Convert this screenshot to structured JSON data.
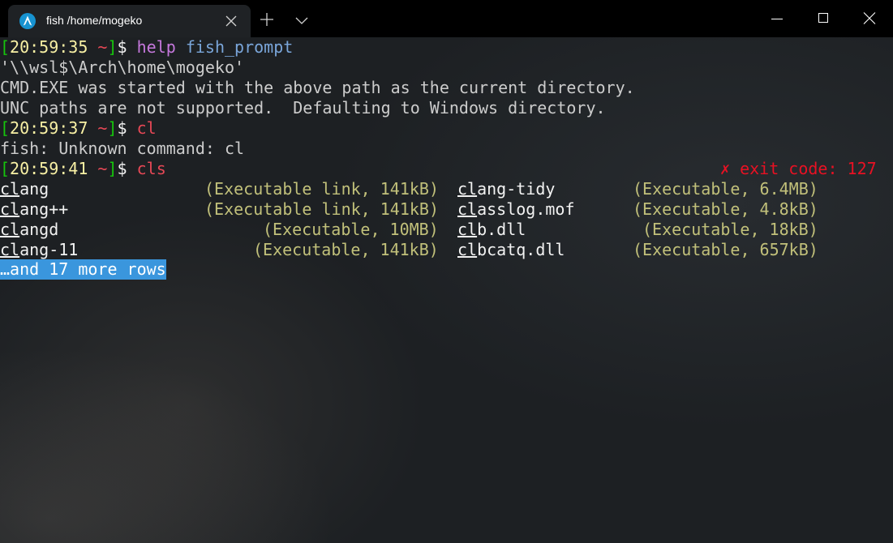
{
  "tab": {
    "title": "fish /home/mogeko",
    "icon": "arch-linux-icon"
  },
  "window_controls": [
    "minimize",
    "maximize",
    "close"
  ],
  "terminal": {
    "lines": [
      {
        "time": "20:59:35",
        "dir": "~",
        "command": "help",
        "arg": "fish_prompt"
      },
      {
        "output": "'\\\\wsl$\\Arch\\home\\mogeko'"
      },
      {
        "output": "CMD.EXE was started with the above path as the current directory."
      },
      {
        "output": "UNC paths are not supported.  Defaulting to Windows directory."
      },
      {
        "time": "20:59:37",
        "dir": "~",
        "command": "cl"
      },
      {
        "output": "fish: Unknown command: cl"
      },
      {
        "time": "20:59:41",
        "dir": "~",
        "command": "cls",
        "exit_code": "✗ exit code: 127"
      }
    ],
    "completions": [
      {
        "prefix": "cl",
        "rest": "ang",
        "desc": "(Executable link, 141kB)"
      },
      {
        "prefix": "cl",
        "rest": "ang-tidy",
        "desc": "(Executable, 6.4MB)"
      },
      {
        "prefix": "cl",
        "rest": "ang++",
        "desc": "(Executable link, 141kB)"
      },
      {
        "prefix": "cl",
        "rest": "asslog.mof",
        "desc": "(Executable, 4.8kB)"
      },
      {
        "prefix": "cl",
        "rest": "angd",
        "desc": "(Executable, 10MB)"
      },
      {
        "prefix": "cl",
        "rest": "b.dll",
        "desc": "(Executable, 18kB)"
      },
      {
        "prefix": "cl",
        "rest": "ang-11",
        "desc": "(Executable, 141kB)"
      },
      {
        "prefix": "cl",
        "rest": "bcatq.dll",
        "desc": "(Executable, 657kB)"
      }
    ],
    "more_rows": "…and 17 more rows"
  },
  "colors": {
    "prompt_bracket": "#16c60c",
    "prompt_time": "#f9f1a5",
    "prompt_dir": "#e74856",
    "command": "#c678dd",
    "argument": "#7aa6da",
    "description": "#c1c07a",
    "error": "#e81123",
    "selection": "#3a96dd"
  }
}
